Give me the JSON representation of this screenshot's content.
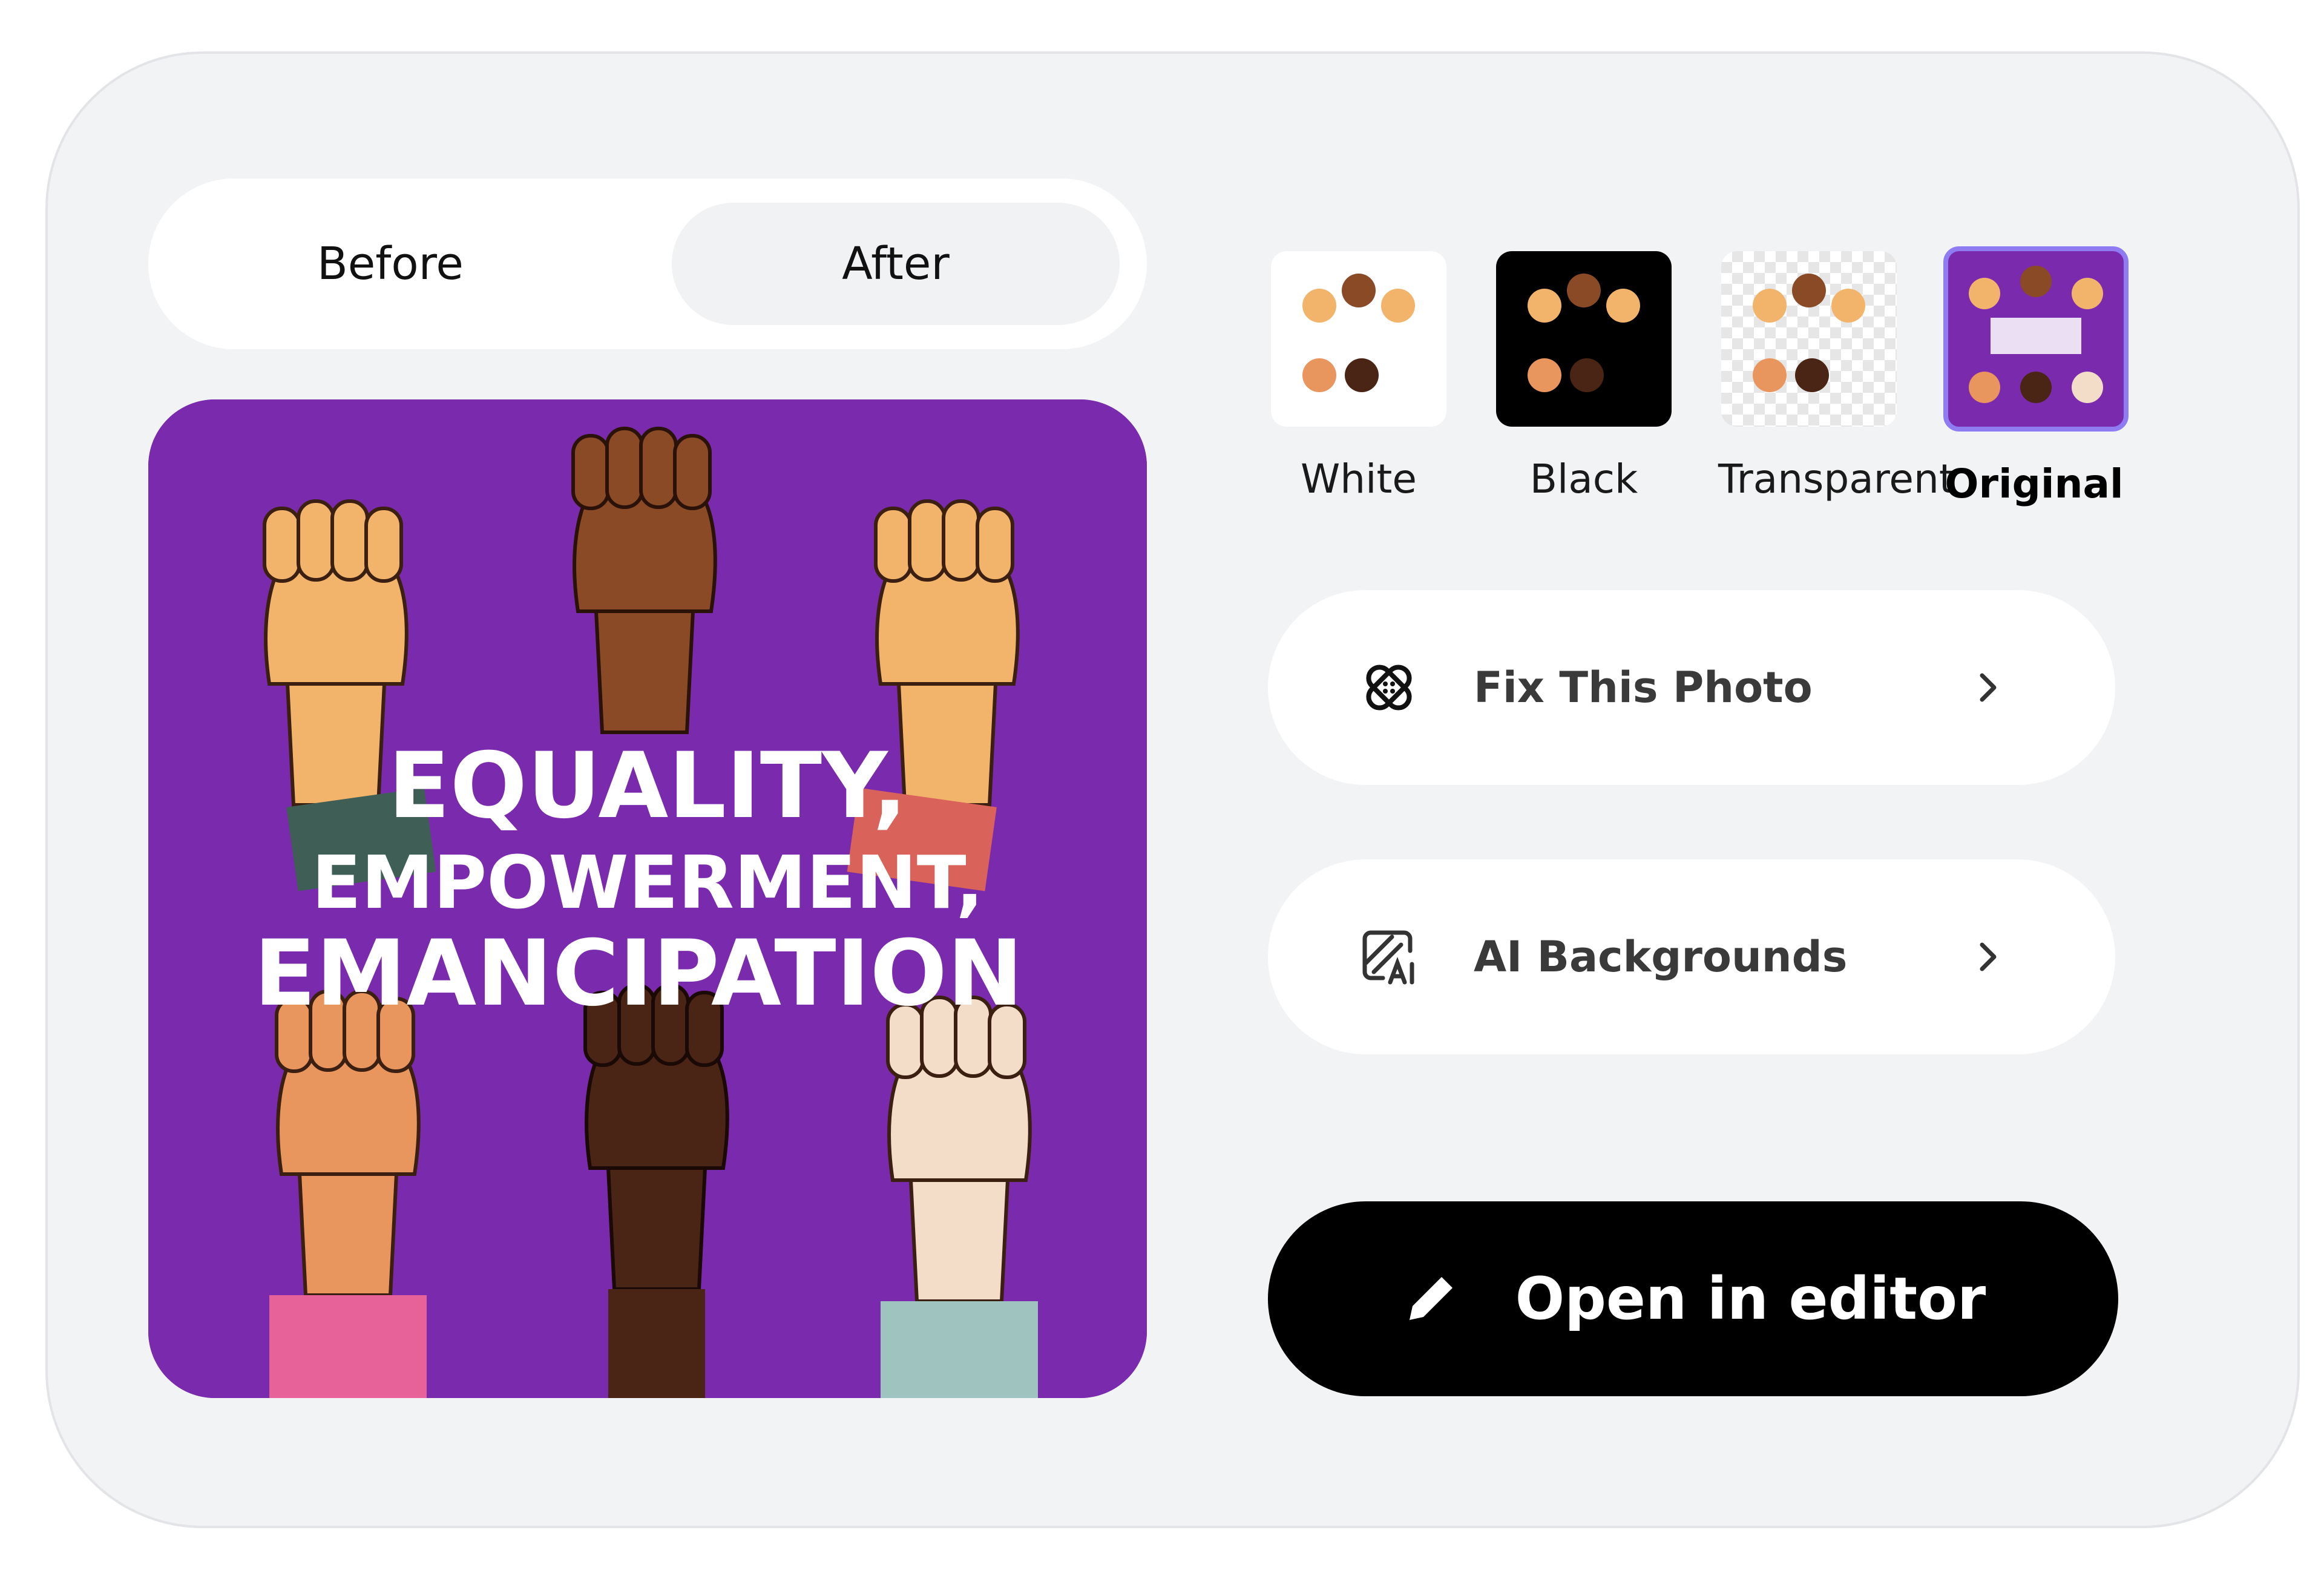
{
  "toggle": {
    "before": "Before",
    "after": "After",
    "active": "After"
  },
  "preview": {
    "lines": [
      "EQUALITY,",
      "EMPOWERMENT,",
      "EMANCIPATION"
    ],
    "bg_color": "#7a2bad"
  },
  "backgrounds": [
    {
      "label": "White",
      "selected": false
    },
    {
      "label": "Black",
      "selected": false
    },
    {
      "label": "Transparent",
      "selected": false
    },
    {
      "label": "Original",
      "selected": true
    }
  ],
  "actions": {
    "fix_photo": "Fix This Photo",
    "ai_backgrounds": "AI Backgrounds"
  },
  "editor_button": "Open in editor",
  "colors": {
    "accent_border": "#8f7cf2",
    "poster_purple": "#7a2bad",
    "card_bg": "#f2f3f5"
  },
  "icons": {
    "fix": "bandage-icon",
    "ai": "ai-backgrounds-icon",
    "chevron": "chevron-right-icon",
    "pencil": "pencil-icon"
  }
}
